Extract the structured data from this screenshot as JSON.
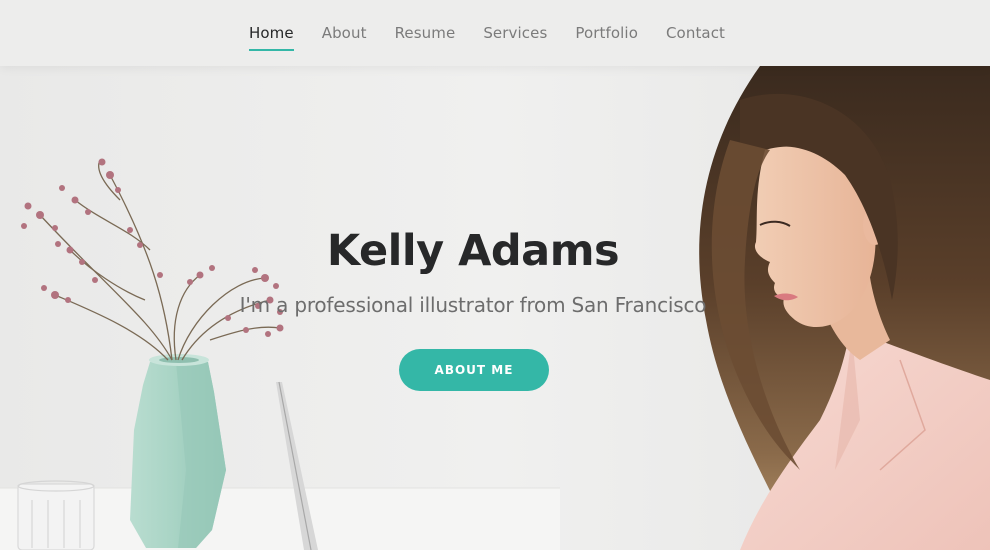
{
  "nav": {
    "items": [
      {
        "label": "Home",
        "active": true
      },
      {
        "label": "About",
        "active": false
      },
      {
        "label": "Resume",
        "active": false
      },
      {
        "label": "Services",
        "active": false
      },
      {
        "label": "Portfolio",
        "active": false
      },
      {
        "label": "Contact",
        "active": false
      }
    ]
  },
  "hero": {
    "title": "Kelly Adams",
    "subtitle": "I'm a professional illustrator from San Francisco",
    "button_label": "ABOUT ME"
  },
  "colors": {
    "accent": "#34b7a7",
    "title": "#272829",
    "nav_inactive": "#7b7b7b",
    "background": "#ececeb"
  }
}
